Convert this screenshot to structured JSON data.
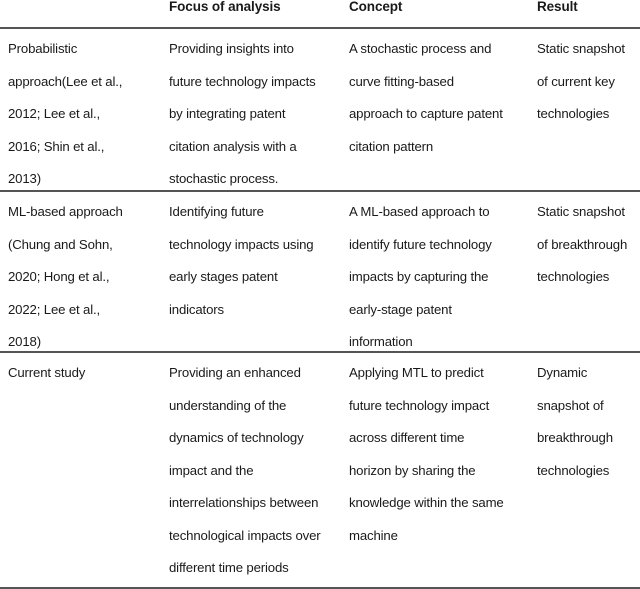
{
  "table": {
    "columns": [
      {
        "key": "approach",
        "label": ""
      },
      {
        "key": "focus",
        "label": "Focus of analysis"
      },
      {
        "key": "concept",
        "label": "Concept"
      },
      {
        "key": "result",
        "label": "Result"
      }
    ],
    "rows": [
      {
        "approach": "Probabilistic\napproach(Lee et al.,\n2012; Lee et al.,\n2016; Shin et al.,\n2013)",
        "focus": "Providing insights into\nfuture technology impacts\nby integrating patent\ncitation analysis with a\nstochastic process.",
        "concept": "A stochastic process and\ncurve fitting-based\napproach to capture patent\ncitation pattern",
        "result": "Static snapshot\nof current key\ntechnologies"
      },
      {
        "approach": "ML-based approach\n(Chung and Sohn,\n2020; Hong et al.,\n2022; Lee et al.,\n2018)",
        "focus": "Identifying future\ntechnology impacts using\nearly stages patent\nindicators",
        "concept": "A ML-based approach to\nidentify future technology\nimpacts by capturing the\nearly-stage patent\ninformation",
        "result": "Static snapshot\nof breakthrough\ntechnologies"
      },
      {
        "approach": "Current study",
        "focus": "Providing an enhanced\nunderstanding of the\ndynamics of technology\nimpact and the\ninterrelationships between\ntechnological impacts over\ndifferent time periods",
        "concept": "Applying MTL to predict\nfuture technology impact\nacross different time\nhorizon by sharing the\nknowledge within the same\nmachine",
        "result": "Dynamic\nsnapshot of\nbreakthrough\ntechnologies"
      }
    ]
  },
  "style": {
    "rule_color": "#555555",
    "text_color": "#1a1a1a",
    "background": "#ffffff"
  }
}
